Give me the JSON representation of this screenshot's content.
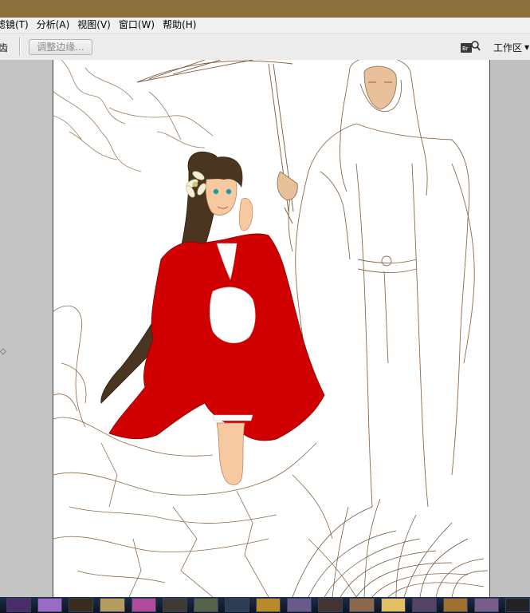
{
  "menubar": {
    "items": [
      {
        "label": "滤镜(T)"
      },
      {
        "label": "分析(A)"
      },
      {
        "label": "视图(V)"
      },
      {
        "label": "窗口(W)"
      },
      {
        "label": "帮助(H)"
      }
    ]
  },
  "optionsbar": {
    "left_label": "齿",
    "refine_edge_label": "调整边缘...",
    "bridge_icon": "bridge-icon",
    "workspace_label": "工作区",
    "workspace_arrow": "▼"
  },
  "canvas": {
    "subject": "illustration of a girl in red kimono and a white-haired man with parasol",
    "colors": {
      "kimono": "#d00000",
      "skin": "#f7c9a1",
      "hair": "#4a3520",
      "lineart": "#8b6a4a",
      "eyes": "#1aa0a0"
    }
  },
  "colors": {
    "title_bar": "#8b6f3c",
    "menu_bg": "#f0f0f0",
    "panel_bg": "#c4c4c4",
    "taskbar": "#1d2b44"
  },
  "taskbar": {
    "thumbnails": [
      "#4a2c6b",
      "#9a6cc7",
      "#3b2a1e",
      "#b69b62",
      "#b04a9a",
      "#3e3a33",
      "#56624a",
      "#2c3c55",
      "#b88a2a",
      "#6a5a8a",
      "#433",
      "#8a6a4a",
      "#e0c060",
      "#546",
      "#a07030",
      "#7a5c8c",
      "#222",
      "#6a7a3a",
      "#c0a070",
      "#333"
    ]
  }
}
